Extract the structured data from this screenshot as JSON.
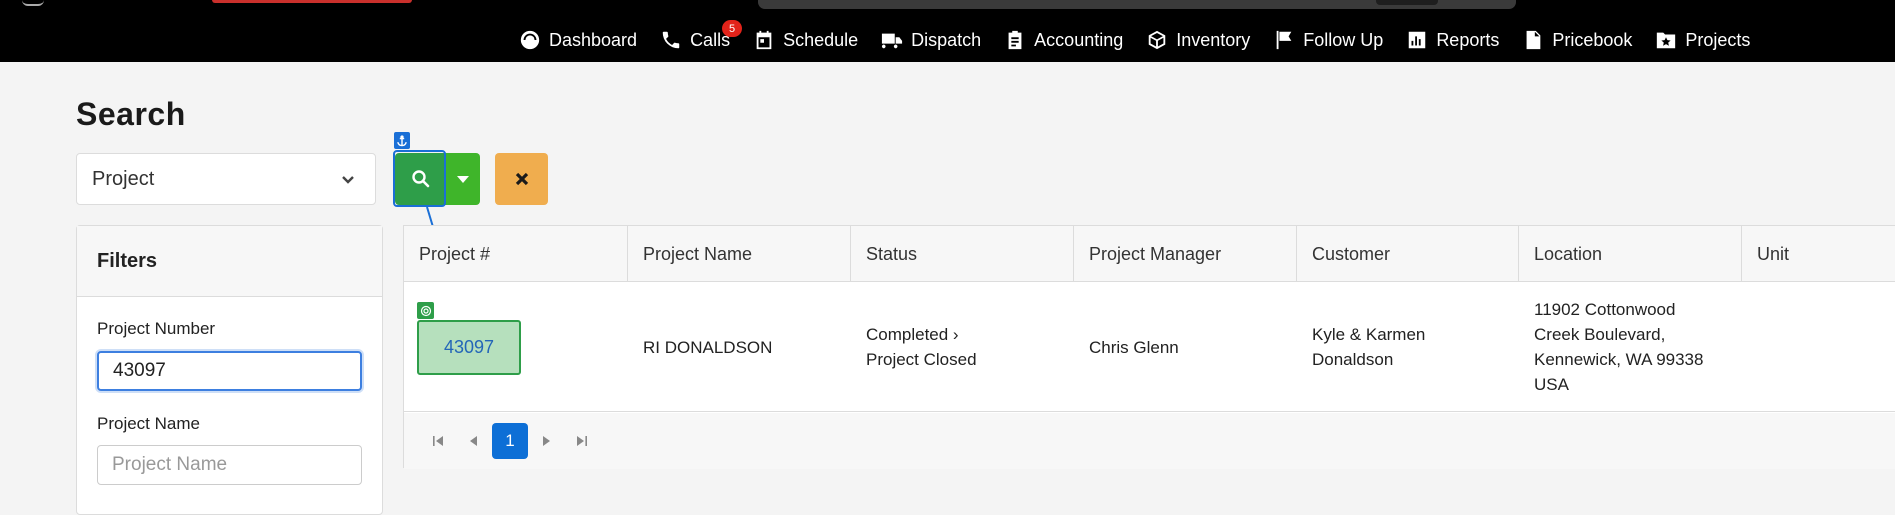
{
  "nav": {
    "items": [
      {
        "label": "Dashboard",
        "icon": "dashboard-icon"
      },
      {
        "label": "Calls",
        "icon": "phone-icon",
        "badge": "5"
      },
      {
        "label": "Schedule",
        "icon": "calendar-icon"
      },
      {
        "label": "Dispatch",
        "icon": "truck-icon"
      },
      {
        "label": "Accounting",
        "icon": "clipboard-icon"
      },
      {
        "label": "Inventory",
        "icon": "box-icon"
      },
      {
        "label": "Follow Up",
        "icon": "flag-icon"
      },
      {
        "label": "Reports",
        "icon": "bar-chart-icon"
      },
      {
        "label": "Pricebook",
        "icon": "book-icon"
      },
      {
        "label": "Projects",
        "icon": "folder-star-icon"
      }
    ]
  },
  "search": {
    "title": "Search",
    "type_value": "Project"
  },
  "filters": {
    "title": "Filters",
    "project_number_label": "Project Number",
    "project_number_value": "43097",
    "project_name_label": "Project Name",
    "project_name_placeholder": "Project Name"
  },
  "table": {
    "columns": [
      "Project #",
      "Project Name",
      "Status",
      "Project Manager",
      "Customer",
      "Location",
      "Unit"
    ],
    "rows": [
      {
        "project_number": "43097",
        "project_name": "RI DONALDSON",
        "status_line1": "Completed ›",
        "status_line2": "Project Closed",
        "project_manager": "Chris Glenn",
        "customer_line1": "Kyle & Karmen",
        "customer_line2": "Donaldson",
        "location_line1": "11902 Cottonwood",
        "location_line2": "Creek Boulevard,",
        "location_line3": "Kennewick, WA 99338",
        "location_line4": "USA",
        "unit": ""
      }
    ]
  },
  "pager": {
    "current_page": "1"
  },
  "colors": {
    "search_button": "#2e9e49",
    "dropdown_button": "#3fb52a",
    "clear_button": "#f0ad4e",
    "page_active": "#0d6fd6",
    "annotation": "#1a6fd6"
  }
}
